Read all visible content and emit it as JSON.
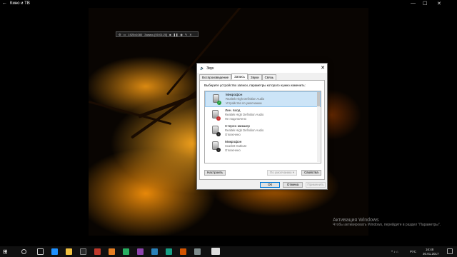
{
  "app": {
    "title": "Кино и ТВ",
    "back_glyph": "←",
    "minimize_glyph": "—",
    "maximize_glyph": "☐",
    "close_glyph": "✕"
  },
  "recorder": {
    "resolution": "1920x1080",
    "status": "Запись [00:01:20]"
  },
  "dialog": {
    "title": "Звук",
    "close_glyph": "✕",
    "tabs": [
      "Воспроизведение",
      "Запись",
      "Звуки",
      "Связь"
    ],
    "active_tab": 1,
    "instruction": "Выберите устройство записи, параметры которого нужно изменить:",
    "devices": [
      {
        "name": "Микрофон",
        "driver": "Realtek High Definition Audio",
        "status": "Устройство по умолчанию",
        "badge": "✓",
        "badge_type": "ok",
        "selected": true
      },
      {
        "name": "Лин. вход",
        "driver": "Realtek High Definition Audio",
        "status": "Не подключено",
        "badge": "↓",
        "badge_type": "off",
        "selected": false
      },
      {
        "name": "Стерео микшер",
        "driver": "Realtek High Definition Audio",
        "status": "Отключено",
        "badge": "↓",
        "badge_type": "down",
        "selected": false
      },
      {
        "name": "Микрофон",
        "driver": "Scarlett Outbust",
        "status": "Отключено",
        "badge": "↓",
        "badge_type": "down",
        "selected": false
      }
    ],
    "buttons": {
      "configure": "Настроить",
      "set_default": "По умолчанию ▾",
      "properties": "Свойства",
      "ok": "ОК",
      "cancel": "Отмена",
      "apply": "Применить"
    }
  },
  "activation": {
    "line1": "Активация Windows",
    "line2": "Чтобы активировать Windows, перейдите в раздел \"Параметры\"."
  },
  "taskbar": {
    "time": "16:48",
    "date": "30.01.2017",
    "language": "РУС"
  }
}
